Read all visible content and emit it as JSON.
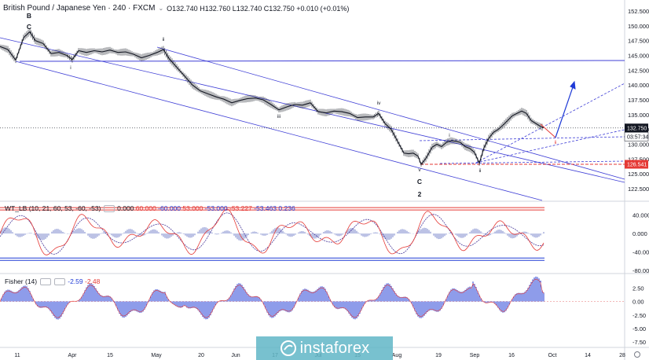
{
  "header": {
    "symbol": "British Pound / Japanese Yen · 240 · FXCM",
    "ohlc": "O132.740 H132.760 L132.740 C132.750 +0.010 (+0.01%)",
    "chevron_icon": "chevron-down-icon"
  },
  "chart_data": [
    {
      "type": "candlestick",
      "title": "British Pound / Japanese Yen · 240 · FXCM",
      "ylim": [
        121.5,
        153.5
      ],
      "y_ticks": [
        "152.500",
        "150.000",
        "147.500",
        "145.000",
        "142.500",
        "140.000",
        "137.500",
        "135.000",
        "132.500",
        "130.000",
        "127.500",
        "125.000",
        "122.500"
      ],
      "x_ticks": [
        "11",
        "Apr",
        "15",
        "May",
        "20",
        "Jun",
        "17",
        "Jul",
        "15",
        "Aug",
        "19",
        "Sep",
        "16",
        "Oct",
        "14",
        "28"
      ],
      "price_path": [
        [
          0,
          146.5
        ],
        [
          10,
          146.0
        ],
        [
          20,
          144.2
        ],
        [
          30,
          148.0
        ],
        [
          38,
          149.0
        ],
        [
          45,
          147.5
        ],
        [
          55,
          147.0
        ],
        [
          65,
          145.3
        ],
        [
          75,
          145.5
        ],
        [
          85,
          145.0
        ],
        [
          92,
          144.3
        ],
        [
          100,
          145.8
        ],
        [
          110,
          145.5
        ],
        [
          120,
          145.8
        ],
        [
          130,
          145.6
        ],
        [
          140,
          145.9
        ],
        [
          150,
          145.5
        ],
        [
          160,
          145.6
        ],
        [
          170,
          145.2
        ],
        [
          180,
          144.6
        ],
        [
          190,
          145.0
        ],
        [
          200,
          145.5
        ],
        [
          208,
          146.0
        ],
        [
          215,
          144.5
        ],
        [
          225,
          143.0
        ],
        [
          235,
          141.5
        ],
        [
          245,
          140.0
        ],
        [
          255,
          139.0
        ],
        [
          265,
          138.5
        ],
        [
          275,
          138.0
        ],
        [
          285,
          137.6
        ],
        [
          295,
          137.0
        ],
        [
          305,
          137.4
        ],
        [
          315,
          137.7
        ],
        [
          325,
          137.8
        ],
        [
          335,
          137.5
        ],
        [
          345,
          136.7
        ],
        [
          355,
          135.8
        ],
        [
          365,
          136.3
        ],
        [
          375,
          136.7
        ],
        [
          385,
          136.6
        ],
        [
          395,
          137.0
        ],
        [
          405,
          135.5
        ],
        [
          415,
          135.3
        ],
        [
          425,
          135.6
        ],
        [
          435,
          135.5
        ],
        [
          445,
          135.2
        ],
        [
          455,
          134.5
        ],
        [
          465,
          134.6
        ],
        [
          475,
          134.6
        ],
        [
          482,
          135.2
        ],
        [
          490,
          133.5
        ],
        [
          498,
          132.5
        ],
        [
          506,
          130.5
        ],
        [
          514,
          128.5
        ],
        [
          520,
          128.4
        ],
        [
          526,
          128.5
        ],
        [
          532,
          128.0
        ],
        [
          536,
          126.6
        ],
        [
          542,
          127.6
        ],
        [
          550,
          129.5
        ],
        [
          556,
          130.0
        ],
        [
          562,
          129.6
        ],
        [
          568,
          130.3
        ],
        [
          574,
          130.6
        ],
        [
          580,
          130.5
        ],
        [
          586,
          130.3
        ],
        [
          592,
          129.6
        ],
        [
          598,
          129.3
        ],
        [
          604,
          128.6
        ],
        [
          610,
          126.8
        ],
        [
          616,
          129.4
        ],
        [
          622,
          131.0
        ],
        [
          628,
          132.0
        ],
        [
          634,
          132.5
        ],
        [
          640,
          133.2
        ],
        [
          646,
          134.0
        ],
        [
          652,
          134.8
        ],
        [
          658,
          135.2
        ],
        [
          664,
          135.6
        ],
        [
          670,
          135.2
        ],
        [
          676,
          134.0
        ],
        [
          682,
          133.5
        ],
        [
          688,
          133.0
        ],
        [
          692,
          132.75
        ]
      ],
      "last_price": "132.750",
      "countdown": "03:57:34",
      "level_label": "126.541",
      "wave_labels": [
        "B",
        "C",
        "i",
        "ii",
        "iii",
        "iv",
        "v",
        "C",
        "2",
        "i",
        "ii",
        "ii"
      ],
      "colors": {
        "up": "#26a69a",
        "candle": "#131722",
        "channel": "#3f3fd6",
        "level": "#e53935",
        "projection": "#1e3ad6"
      }
    },
    {
      "type": "line",
      "title": "WT_LB",
      "params": "(10, 21, 60, 53, -60, -53)",
      "values_text": [
        "0.000",
        "60.000",
        "-60.000",
        "53.000",
        "-53.000",
        "-53.227",
        "-53.463",
        "0.236"
      ],
      "ylim": [
        -85,
        60
      ],
      "y_ticks": [
        "40.000",
        "0.000",
        "-40.000",
        "-80.000"
      ],
      "ref_levels": [
        60,
        53,
        -53,
        -60
      ],
      "last_values": [
        -53.227,
        -53.463
      ],
      "colors": {
        "wt1": "#e53935",
        "wt2": "#4a3a9a",
        "hist": "#9fa8da",
        "upper": "#e53935",
        "lower": "#1e3ad6"
      }
    },
    {
      "type": "histogram",
      "title": "Fisher",
      "params": "(14)",
      "values_text": [
        "-2.59",
        "-2.48"
      ],
      "ylim": [
        -8.2,
        4.0
      ],
      "y_ticks": [
        "2.50",
        "0.00",
        "-2.50",
        "-5.00",
        "-7.50"
      ],
      "last_values": [
        -2.59,
        -2.48
      ],
      "colors": {
        "bar": "#1e3ad6",
        "signal": "#e53935"
      }
    }
  ],
  "watermark": {
    "text": "instaforex"
  }
}
